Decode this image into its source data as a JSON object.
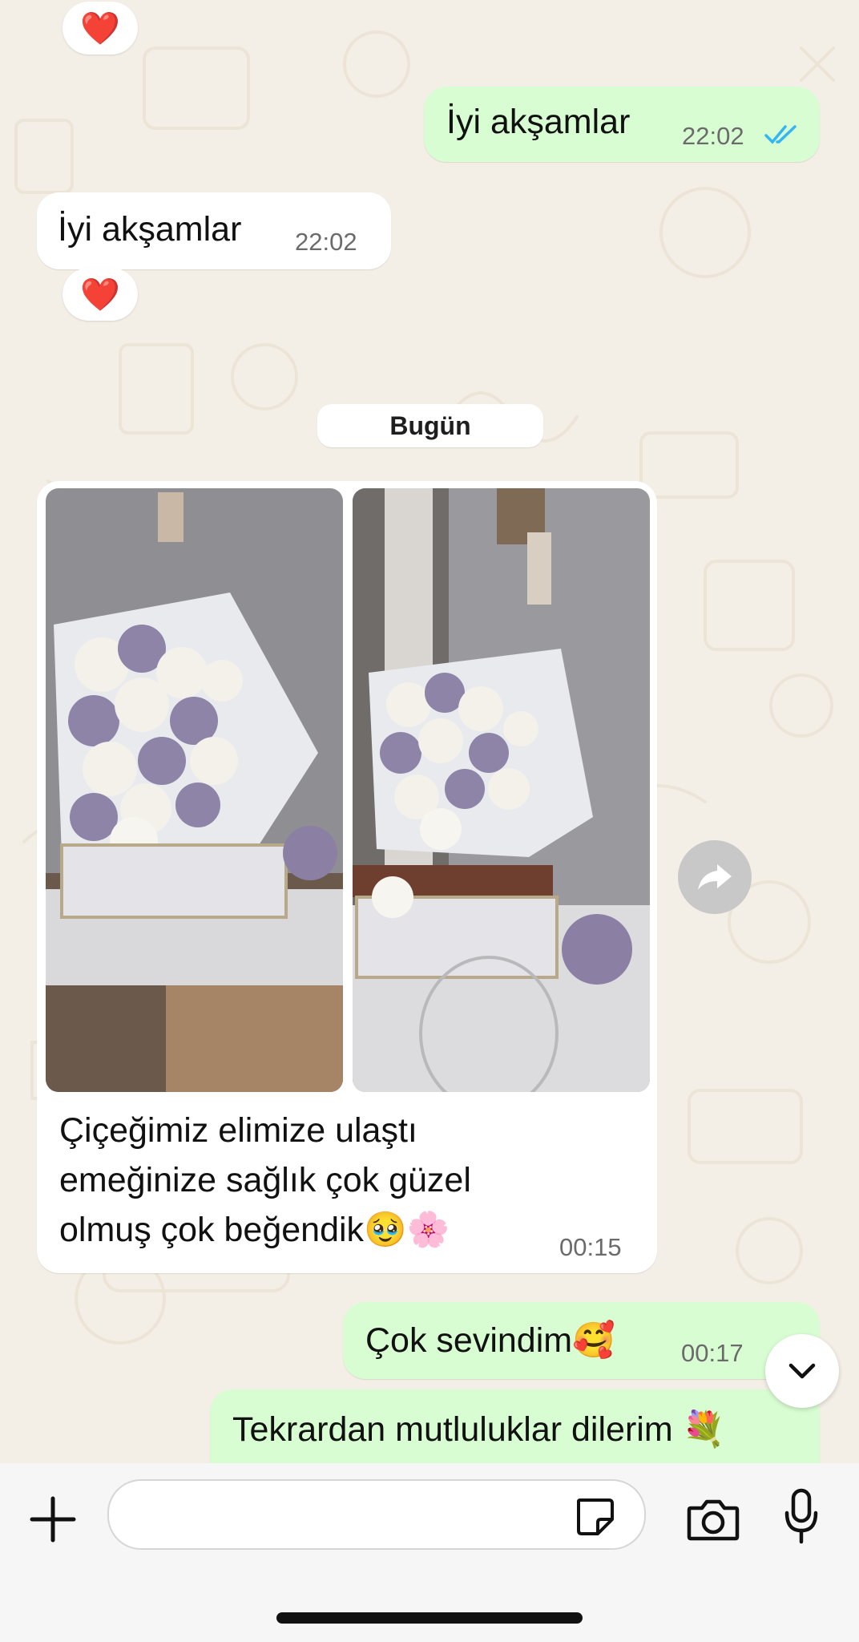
{
  "colors": {
    "incoming_bubble": "#ffffff",
    "outgoing_bubble": "#d9fdd3",
    "chat_background": "#f4efe6",
    "read_ticks": "#34b7f1",
    "reaction": "#e8192c"
  },
  "messages": [
    {
      "id": "m1",
      "direction": "outgoing",
      "text": "İyi akşamlar",
      "time": "22:02",
      "status_icon": "double-check-read-icon"
    },
    {
      "id": "m2",
      "direction": "incoming",
      "text": "İyi akşamlar",
      "time": "22:02",
      "reaction": "❤️"
    },
    {
      "id": "m3",
      "direction": "incoming",
      "type": "album",
      "caption_lines": [
        "Çiçeğimiz elimize ulaştı",
        "emeğinize sağlık çok güzel",
        "olmuş çok beğendik🥹🌸"
      ],
      "time": "00:15"
    },
    {
      "id": "m4",
      "direction": "outgoing",
      "text": "Çok sevindim🥰",
      "time": "00:17"
    },
    {
      "id": "m5",
      "direction": "outgoing",
      "text": "Tekrardan mutluluklar dilerim 💐"
    }
  ],
  "top_reaction": "❤️",
  "date_separator": "Bugün",
  "icons": {
    "forward": "forward-arrow-icon",
    "scroll_down": "chevron-down-icon",
    "attach": "plus-icon",
    "sticker": "sticker-icon",
    "camera": "camera-icon",
    "mic": "microphone-icon"
  },
  "composer": {
    "placeholder": ""
  }
}
